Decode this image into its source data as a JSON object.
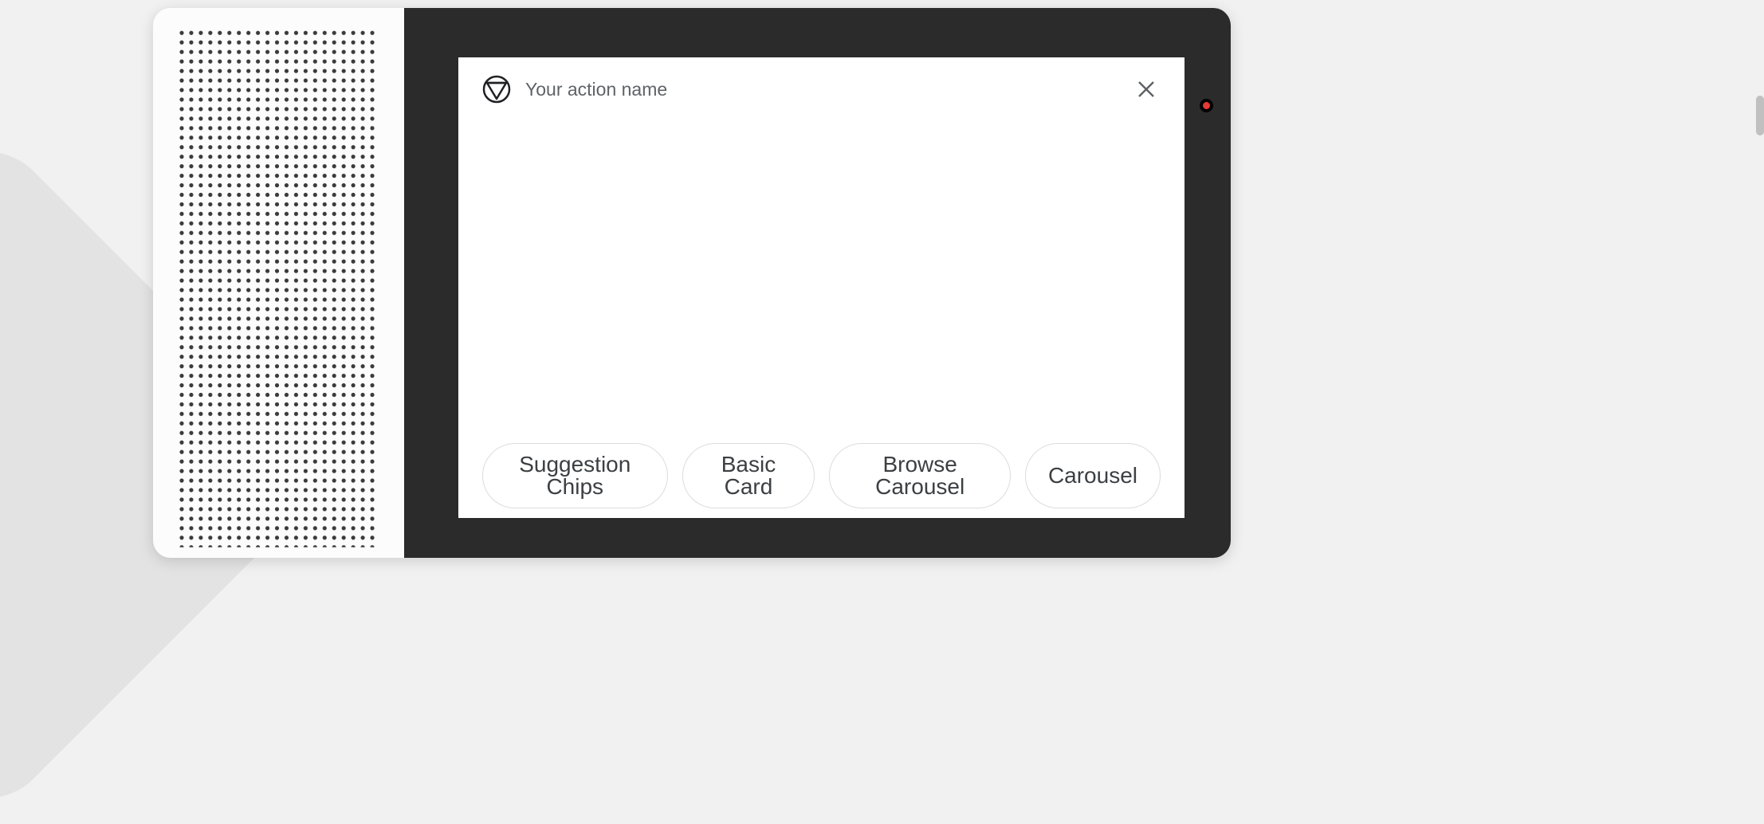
{
  "header": {
    "action_name": "Your action name"
  },
  "chips": [
    {
      "label": "Suggestion Chips"
    },
    {
      "label": "Basic Card"
    },
    {
      "label": "Browse Carousel"
    },
    {
      "label": "Carousel"
    }
  ]
}
